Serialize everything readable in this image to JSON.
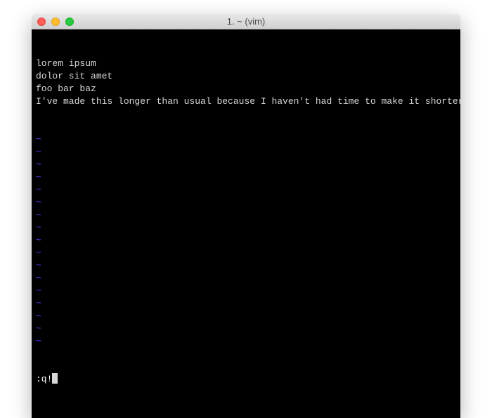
{
  "window": {
    "title": "1. ~ (vim)"
  },
  "buffer": {
    "lines": [
      "lorem ipsum",
      "dolor sit amet",
      "foo bar baz",
      "I've made this longer than usual because I haven't had time to make it shorter."
    ],
    "tilde": "~",
    "tilde_rows": 17
  },
  "command": {
    "text": ":q!"
  },
  "colors": {
    "background": "#000000",
    "text": "#d8d8d8",
    "tilde": "#4b3fff"
  }
}
